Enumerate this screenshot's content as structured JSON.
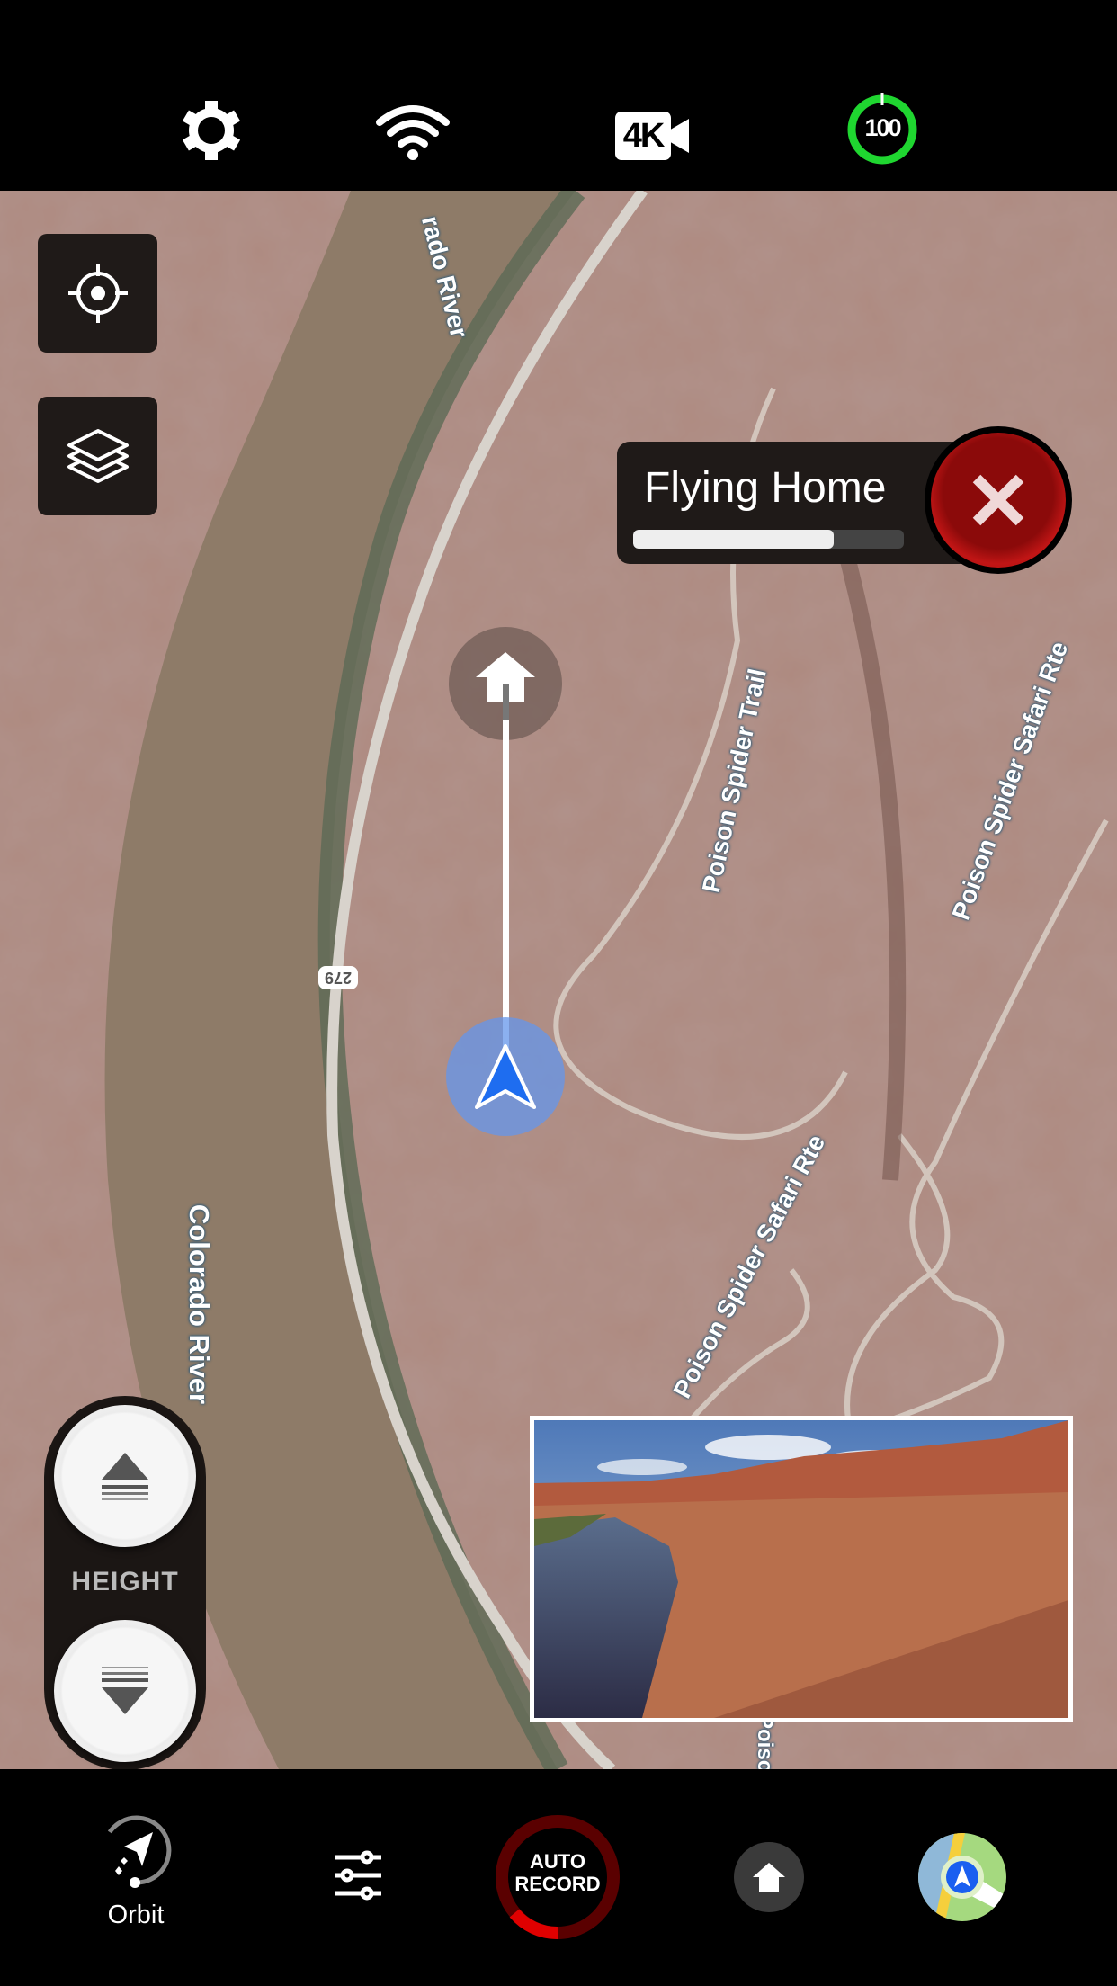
{
  "status_bar": {
    "settings_icon": "gear-icon",
    "wifi_icon": "wifi-icon",
    "resolution": "4K",
    "battery_level": "100",
    "battery_percent": 100,
    "battery_color": "#1fd630"
  },
  "map": {
    "labels": {
      "river_top": "rado River",
      "river_main": "Colorado River",
      "trail": "Poison Spider Trail",
      "safari_right": "Poison Spider Safari Rte",
      "safari_left": "Poison Spider Safari Rte",
      "road_shield": "279",
      "bottom_partial": "Poison"
    },
    "locate_icon": "crosshair-icon",
    "layers_icon": "layers-icon"
  },
  "flying_home": {
    "title": "Flying Home",
    "progress_percent": 74,
    "cancel_color": "#b01010"
  },
  "height_control": {
    "label": "HEIGHT"
  },
  "bottom_bar": {
    "orbit_label": "Orbit",
    "auto_record_line1": "AUTO",
    "auto_record_line2": "RECORD",
    "record_accent": "#e00000"
  }
}
